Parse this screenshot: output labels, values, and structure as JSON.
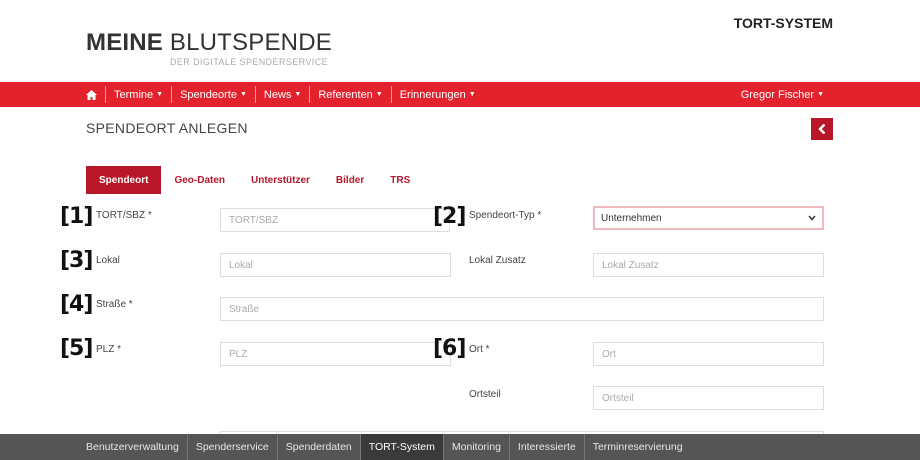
{
  "brand": {
    "bold": "MEINE",
    "light": "BLUTSPENDE",
    "subtitle": "DER DIGITALE SPENDERSERVICE"
  },
  "system_title": "TORT-SYSTEM",
  "nav": {
    "home_icon": "home-icon",
    "items": [
      "Termine",
      "Spendeorte",
      "News",
      "Referenten",
      "Erinnerungen"
    ],
    "user": "Gregor Fischer"
  },
  "page": {
    "title": "SPENDEORT ANLEGEN",
    "back_icon": "chevron-left-icon"
  },
  "tabs": [
    {
      "label": "Spendeort",
      "active": true
    },
    {
      "label": "Geo-Daten"
    },
    {
      "label": "Unterstützer"
    },
    {
      "label": "Bilder"
    },
    {
      "label": "TRS"
    }
  ],
  "markers": [
    "[1]",
    "[2]",
    "[3]",
    "[4]",
    "[5]",
    "[6]"
  ],
  "form": {
    "tort_label": "TORT/SBZ *",
    "tort_placeholder": "TORT/SBZ",
    "typ_label": "Spendeort-Typ *",
    "typ_value": "Unternehmen",
    "lokal_label": "Lokal",
    "lokal_placeholder": "Lokal",
    "lokal_zusatz_label": "Lokal Zusatz",
    "lokal_zusatz_placeholder": "Lokal Zusatz",
    "strasse_label": "Straße *",
    "strasse_placeholder": "Straße",
    "plz_label": "PLZ *",
    "plz_placeholder": "PLZ",
    "ort_label": "Ort *",
    "ort_placeholder": "Ort",
    "ortsteil_label": "Ortsteil",
    "ortsteil_placeholder": "Ortsteil"
  },
  "bottom_nav": {
    "items": [
      "Benutzerverwaltung",
      "Spenderservice",
      "Spenderdaten",
      "TORT-System",
      "Monitoring",
      "Interessierte",
      "Terminreservierung"
    ],
    "active_index": 3
  },
  "colors": {
    "nav_red": "#e3222d",
    "accent_dark_red": "#b8172a",
    "bottom_bar": "#555555"
  }
}
